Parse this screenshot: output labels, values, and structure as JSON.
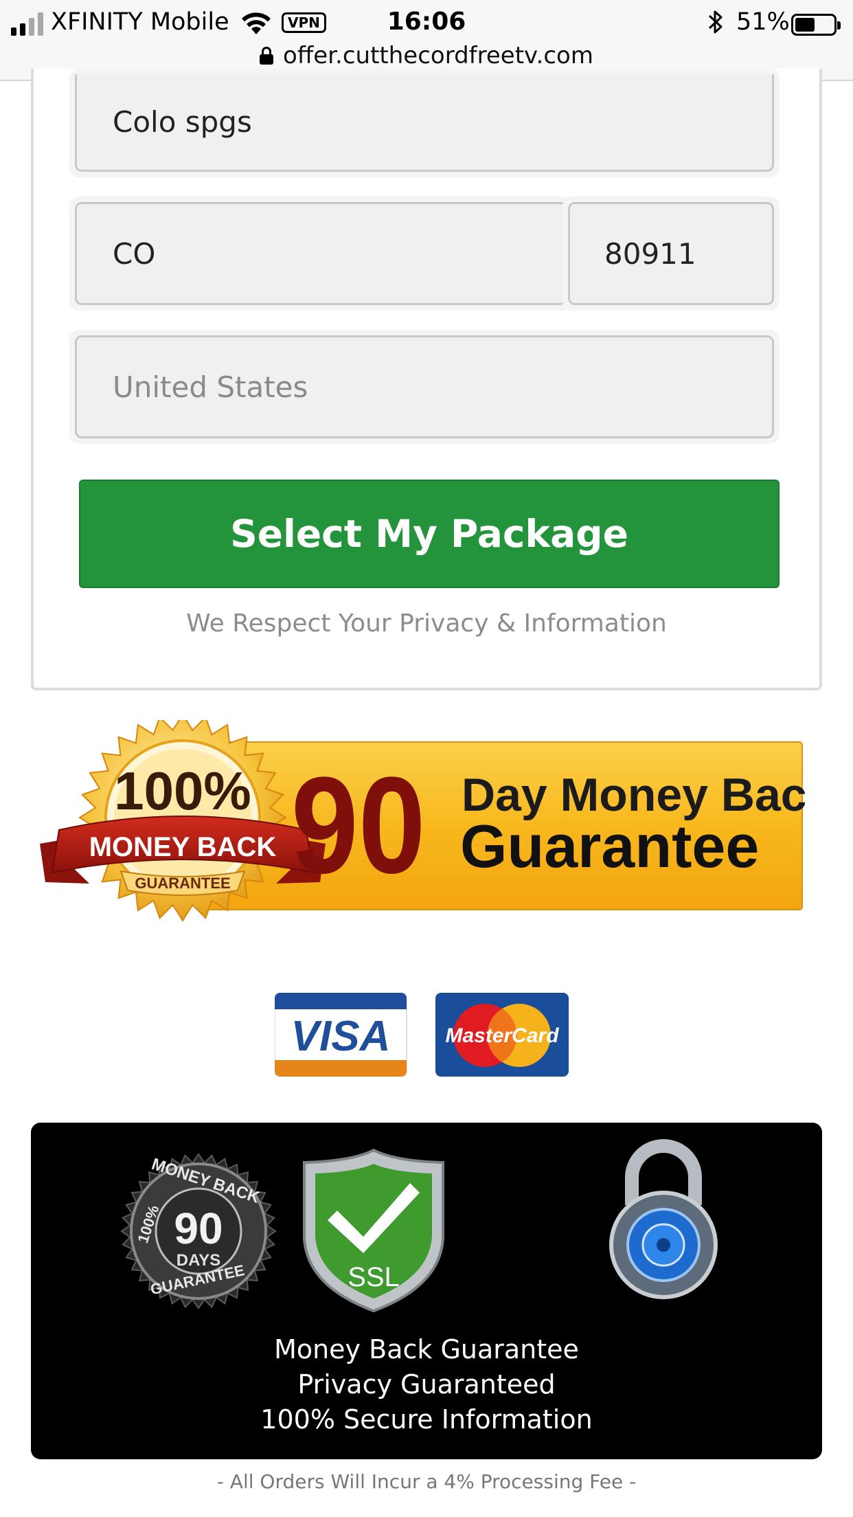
{
  "status_bar": {
    "carrier": "XFINITY Mobile",
    "vpn_label": "VPN",
    "time": "16:06",
    "battery_percent": "51%",
    "battery_level": 0.51,
    "signal_bars": 2,
    "url": "offer.cutthecordfreetv.com"
  },
  "form": {
    "city_value": "Colo spgs",
    "state_value": "CO",
    "zip_value": "80911",
    "country_placeholder": "United States",
    "submit_label": "Select My Package",
    "privacy_note": "We Respect Your Privacy & Information"
  },
  "guarantee_banner": {
    "seal_percent": "100%",
    "seal_ribbon": "MONEY BACK",
    "seal_bottom": "GUARANTEE",
    "days": "90",
    "line1": "Day Money Back",
    "line2": "Guarantee"
  },
  "payment_cards": {
    "visa_label": "VISA",
    "mastercard_label": "MasterCard"
  },
  "trust_badges": {
    "days_badge_number": "90",
    "days_badge_unit": "DAYS",
    "days_badge_ring_top": "MONEY BACK",
    "days_badge_ring_left": "100%",
    "days_badge_ring_bottom": "GUARANTEE",
    "ssl_label": "SSL",
    "lines": [
      "Money Back Guarantee",
      "Privacy Guaranteed",
      "100% Secure Information"
    ]
  },
  "footer": {
    "fee_note": "- All Orders Will Incur a 4% Processing Fee -"
  },
  "colors": {
    "cta_green": "#23943c",
    "banner_yellow": "#f8bb22",
    "ribbon_red": "#b01a12"
  }
}
